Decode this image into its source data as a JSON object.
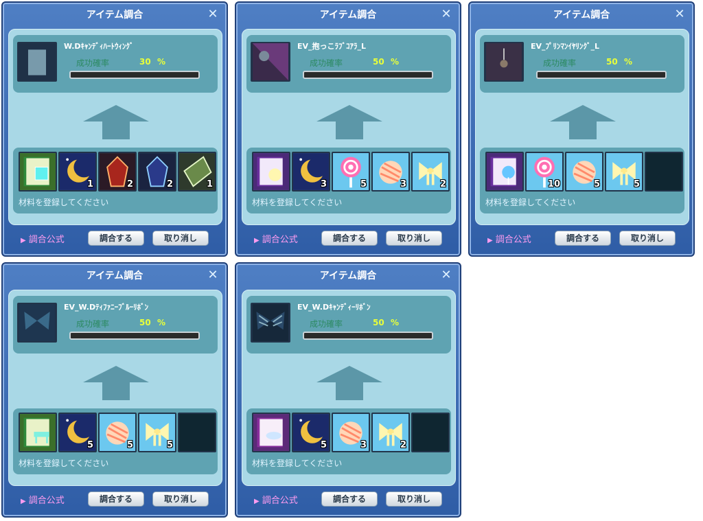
{
  "dialogs": [
    {
      "title": "アイテム調合",
      "result": {
        "name": "W.Dｷｬﾝﾃﾞｨﾊｰﾄｳｨﾝｸﾞ",
        "icon": "winged-heart-item-icon"
      },
      "rate_label": "成功確率",
      "rate_value": "30",
      "rate_unit": "%",
      "progress": 0,
      "materials": [
        {
          "icon": "book-gem-icon",
          "qty": ""
        },
        {
          "icon": "moon-icon",
          "qty": "1"
        },
        {
          "icon": "red-crystal-icon",
          "qty": "2"
        },
        {
          "icon": "blue-crystal-icon",
          "qty": "2"
        },
        {
          "icon": "green-crystal-icon",
          "qty": "1"
        }
      ],
      "hint": "材料を登録してください",
      "formula_label": "調合公式",
      "craft_label": "調合する",
      "cancel_label": "取り消し"
    },
    {
      "title": "アイテム調合",
      "result": {
        "name": "EV_抱っこﾗﾌﾞｺｱﾗ_L",
        "icon": "koala-item-icon"
      },
      "rate_label": "成功確率",
      "rate_value": "50",
      "rate_unit": "%",
      "progress": 0,
      "materials": [
        {
          "icon": "book-bow-icon",
          "qty": ""
        },
        {
          "icon": "moon-icon",
          "qty": "3"
        },
        {
          "icon": "lollipop-icon",
          "qty": "5"
        },
        {
          "icon": "candy-icon",
          "qty": "3"
        },
        {
          "icon": "ribbon-icon",
          "qty": "2"
        }
      ],
      "hint": "材料を登録してください",
      "formula_label": "調合公式",
      "craft_label": "調合する",
      "cancel_label": "取り消し"
    },
    {
      "title": "アイテム調合",
      "result": {
        "name": "EV_ﾌﾟﾘﾝﾏﾝｲﾔﾘﾝｸﾞ_L",
        "icon": "earring-item-icon"
      },
      "rate_label": "成功確率",
      "rate_value": "50",
      "rate_unit": "%",
      "progress": 0,
      "materials": [
        {
          "icon": "book-lollipop-icon",
          "qty": ""
        },
        {
          "icon": "lollipop-icon",
          "qty": "10"
        },
        {
          "icon": "candy-icon",
          "qty": "5"
        },
        {
          "icon": "ribbon-icon",
          "qty": "5"
        },
        {
          "icon": "empty-slot",
          "qty": ""
        }
      ],
      "hint": "材料を登録してください",
      "formula_label": "調合公式",
      "craft_label": "調合する",
      "cancel_label": "取り消し"
    },
    {
      "title": "アイテム調合",
      "result": {
        "name": "EV_W.Dﾃｨﾌｧﾆｰﾌﾞﾙｰﾘﾎﾞﾝ",
        "icon": "blue-ribbon-item-icon"
      },
      "rate_label": "成功確率",
      "rate_value": "50",
      "rate_unit": "%",
      "progress": 0,
      "materials": [
        {
          "icon": "book-table-icon",
          "qty": ""
        },
        {
          "icon": "moon-icon",
          "qty": "5"
        },
        {
          "icon": "candy-icon",
          "qty": "5"
        },
        {
          "icon": "ribbon-icon",
          "qty": "5"
        },
        {
          "icon": "empty-slot",
          "qty": ""
        }
      ],
      "hint": "材料を登録してください",
      "formula_label": "調合公式",
      "craft_label": "調合する",
      "cancel_label": "取り消し"
    },
    {
      "title": "アイテム調合",
      "result": {
        "name": "EV_W.Dｷｬﾝﾃﾞｨｰﾘﾎﾞﾝ",
        "icon": "striped-ribbon-item-icon"
      },
      "rate_label": "成功確率",
      "rate_value": "50",
      "rate_unit": "%",
      "progress": 0,
      "materials": [
        {
          "icon": "book-cup-icon",
          "qty": ""
        },
        {
          "icon": "moon-icon",
          "qty": "5"
        },
        {
          "icon": "candy-icon",
          "qty": "3"
        },
        {
          "icon": "ribbon-icon",
          "qty": "2"
        },
        {
          "icon": "empty-slot",
          "qty": ""
        }
      ],
      "hint": "材料を登録してください",
      "formula_label": "調合公式",
      "craft_label": "調合する",
      "cancel_label": "取り消し"
    }
  ],
  "colors": {
    "dialog_bg": "#3f70b8",
    "panel_bg": "#a9d8e6",
    "panel_inner": "#5fa3b2",
    "rate_label": "#2c8a62",
    "rate_value": "#e8ff3a",
    "formula_text": "#ff9cf0"
  }
}
